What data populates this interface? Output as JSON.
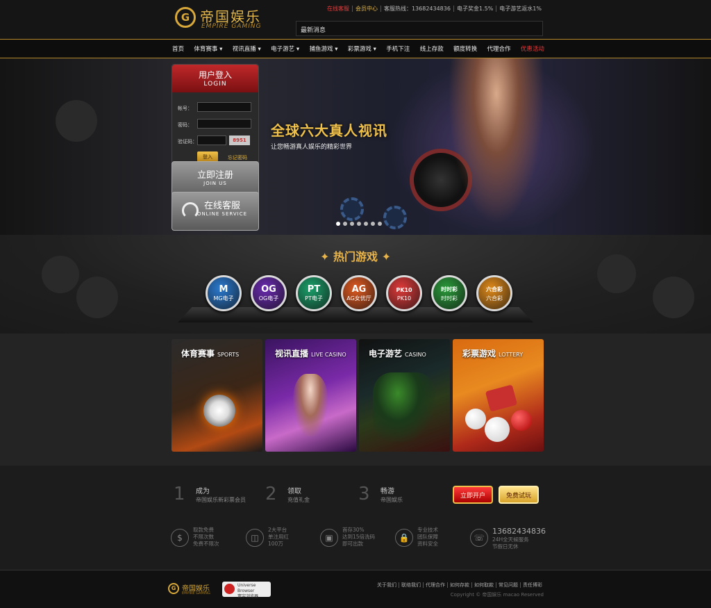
{
  "header": {
    "logo_cn": "帝国娱乐",
    "logo_en": "EMPIRE GAMING",
    "toplinks": [
      "在线客服",
      "会员中心",
      "客服热线：13682434836",
      "电子奖金1.5%",
      "电子游艺返水1%"
    ],
    "news_label": "最新消息"
  },
  "nav": {
    "items": [
      "首页",
      "体育赛事 ▾",
      "视讯直播 ▾",
      "电子游艺 ▾",
      "捕鱼游戏 ▾",
      "彩票游戏 ▾",
      "手机下注",
      "线上存款",
      "额度转换",
      "代理合作",
      "优惠活动"
    ]
  },
  "banner": {
    "title": "全球六大真人视讯",
    "subtitle": "让您畅游真人娱乐的精彩世界",
    "dots_count": 7,
    "active_dot": 0
  },
  "login": {
    "title_cn": "用户登入",
    "title_en": "LOGIN",
    "account_label": "帐号：",
    "password_label": "密码：",
    "captcha_label": "验证码：",
    "captcha_value": "8951",
    "login_button": "登入",
    "forgot_link": "忘记密码",
    "register_cn": "立即注册",
    "register_en": "JOIN US",
    "service_cn": "在线客服",
    "service_en": "ONLINE SERVICE"
  },
  "hot_games": {
    "title": "热门游戏",
    "games": [
      {
        "label": "MG电子",
        "icon": "M",
        "color": "#2a7ad0"
      },
      {
        "label": "OG电子",
        "icon": "OG",
        "color": "#6a2ab0"
      },
      {
        "label": "PT电子",
        "icon": "PT",
        "color": "#1aa06a"
      },
      {
        "label": "AG女优厅",
        "icon": "AG",
        "color": "#e05a20"
      },
      {
        "label": "PK10",
        "icon": "PK10",
        "color": "#e03a3a"
      },
      {
        "label": "时时彩",
        "icon": "时时彩",
        "color": "#2a9a3a"
      },
      {
        "label": "六合彩",
        "icon": "六合彩",
        "color": "#e08a1a"
      }
    ]
  },
  "categories": [
    {
      "cn": "体育赛事",
      "en": "SPORTS"
    },
    {
      "cn": "视讯直播",
      "en": "LIVE CASINO"
    },
    {
      "cn": "电子游艺",
      "en": "CASINO"
    },
    {
      "cn": "彩票游戏",
      "en": "LOTTERY"
    }
  ],
  "steps": [
    {
      "num": "1",
      "title": "成为",
      "desc": "帝国娱乐新彩票会员"
    },
    {
      "num": "2",
      "title": "领取",
      "desc": "充值礼金"
    },
    {
      "num": "3",
      "title": "畅游",
      "desc": "帝国娱乐"
    }
  ],
  "step_buttons": {
    "open": "立即开户",
    "try": "免费试玩"
  },
  "features": [
    {
      "icon": "dollar-icon",
      "glyph": "$",
      "lines": [
        "取款免费",
        "不限次数",
        "免费不限次"
      ]
    },
    {
      "icon": "platform-icon",
      "glyph": "◫",
      "lines": [
        "2大平台",
        "单注用红",
        "100万"
      ]
    },
    {
      "icon": "money-icon",
      "glyph": "▣",
      "lines": [
        "首存30%",
        "达到15倍洗码",
        "即可出款"
      ]
    },
    {
      "icon": "lock-icon",
      "glyph": "🔒",
      "lines": [
        "专业技术",
        "团队保障",
        "资料安全"
      ]
    },
    {
      "icon": "phone-icon",
      "glyph": "☏",
      "phone": "13682434836",
      "lines": [
        "24H全天候服务",
        "节假日无休"
      ]
    }
  ],
  "footer": {
    "logo_cn": "帝国娱乐",
    "logo_en": "EMPIRE GAMING",
    "browser_en": "Universe Browser",
    "browser_cn": "寰宇浏览器",
    "links": [
      "关于我们",
      "联络我们",
      "代理合作",
      "如何存款",
      "如何取款",
      "常见问题",
      "责任博彩"
    ],
    "copyright": "Copyright © 帝国娱乐 macao Reserved"
  }
}
